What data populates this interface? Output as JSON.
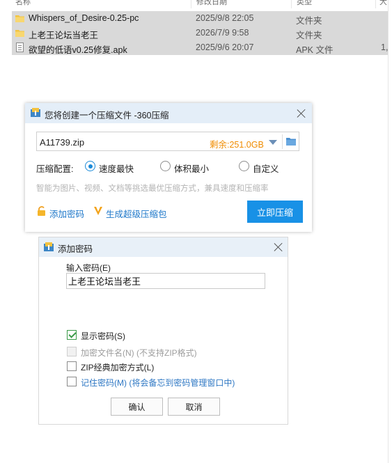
{
  "explorer": {
    "columns": [
      "名称",
      "修改日期",
      "类型",
      "大"
    ],
    "files": [
      {
        "name": "Whispers_of_Desire-0.25-pc",
        "date": "2025/9/8 22:05",
        "type": "文件夹",
        "size": "",
        "icon": "folder-icon"
      },
      {
        "name": "上老王论坛当老王",
        "date": "2026/7/9 9:58",
        "type": "文件夹",
        "size": "",
        "icon": "folder-icon"
      },
      {
        "name": "欲望的低语v0.25修复.apk",
        "date": "2025/9/6 20:07",
        "type": "APK 文件",
        "size": "1,",
        "icon": "file-icon"
      }
    ]
  },
  "compress_dialog": {
    "title": "您将创建一个压缩文件 -360压缩",
    "path_value": "A11739.zip",
    "free_space": "剩余:251.0GB",
    "config_label": "压缩配置:",
    "options": [
      "速度最快",
      "体积最小",
      "自定义"
    ],
    "selected_option": "速度最快",
    "hint": "智能为图片、视频、文档等挑选最优压缩方式，兼具速度和压缩率",
    "add_password_label": "添加密码",
    "super_package_label": "生成超级压缩包",
    "compress_button": "立即压缩",
    "accent_color": "#1891e6",
    "free_space_color": "#f08c00"
  },
  "password_dialog": {
    "title": "添加密码",
    "input_label": "输入密码(E)",
    "input_value": "上老王论坛当老王",
    "checkboxes": [
      {
        "label": "显示密码(S)",
        "checked": true,
        "enabled": true
      },
      {
        "label": "加密文件名(N) (不支持ZIP格式)",
        "checked": false,
        "enabled": false
      },
      {
        "label": "ZIP经典加密方式(L)",
        "checked": false,
        "enabled": true
      },
      {
        "label": "记住密码(M) (将会备忘到密码管理窗口中)",
        "checked": false,
        "enabled": true
      }
    ],
    "ok_button": "确认",
    "cancel_button": "取消"
  }
}
